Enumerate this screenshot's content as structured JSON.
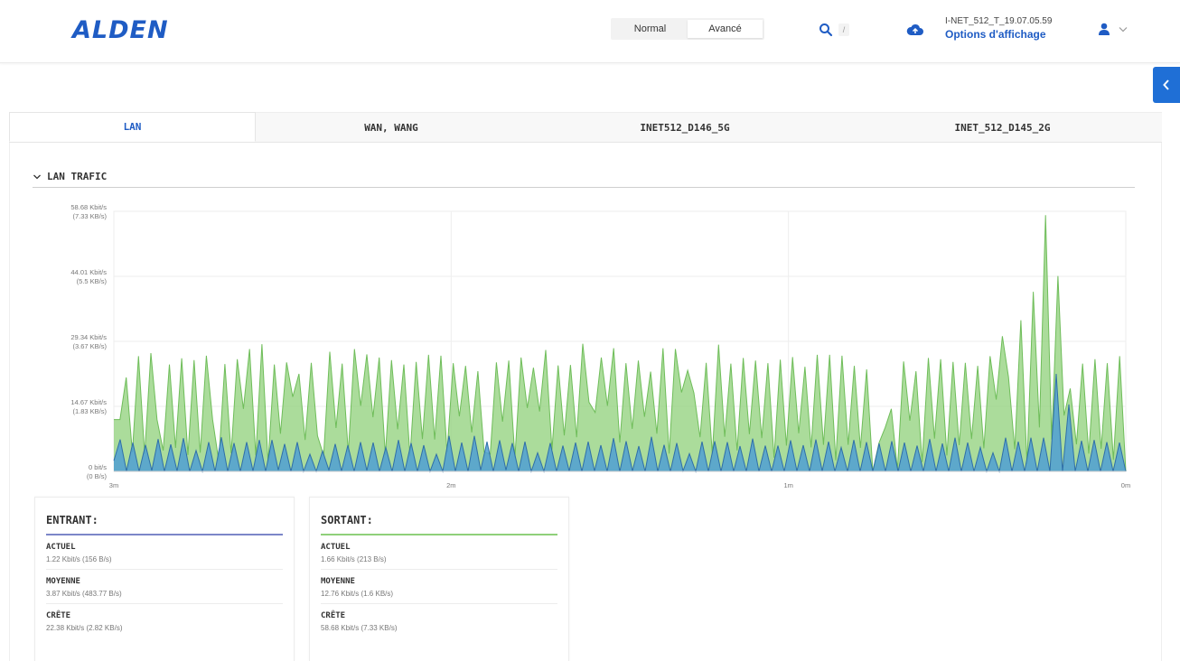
{
  "header": {
    "logo": "ALDEN",
    "modes": [
      "Normal",
      "Avancé"
    ],
    "active_mode": "Avancé",
    "search_shortcut": "/",
    "device_name": "I-NET_512_T_19.07.05.59",
    "display_options": "Options d'affichage"
  },
  "tabs": [
    {
      "label": "LAN",
      "active": true
    },
    {
      "label": "WAN, WANG",
      "active": false
    },
    {
      "label": "INET512_D146_5G",
      "active": false
    },
    {
      "label": "INET_512_D145_2G",
      "active": false
    }
  ],
  "section": {
    "title": "LAN TRAFIC"
  },
  "chart_data": {
    "type": "area",
    "y_tick_labels": [
      [
        "58.68 Kbit/s",
        "(7.33 KB/s)"
      ],
      [
        "44.01 Kbit/s",
        "(5.5 KB/s)"
      ],
      [
        "29.34 Kbit/s",
        "(3.67 KB/s)"
      ],
      [
        "14.67 Kbit/s",
        "(1.83 KB/s)"
      ],
      [
        "0 bit/s",
        "(0 B/s)"
      ]
    ],
    "y_ticks": [
      58.68,
      44.01,
      29.34,
      14.67,
      0
    ],
    "ylim": [
      0,
      58.68
    ],
    "y_unit": "Kbit/s",
    "x_tick_labels": [
      "3m",
      "2m",
      "1m",
      "0m"
    ],
    "x_ticks": [
      3,
      2,
      1,
      0
    ],
    "xlim": [
      3,
      0
    ],
    "grid": true,
    "series": [
      {
        "name": "SORTANT",
        "color": "#8fd07a",
        "values": [
          11.7,
          11.7,
          21.2,
          4.3,
          26.0,
          3.9,
          26.7,
          11.7,
          4.7,
          24.1,
          5.3,
          25.5,
          3.7,
          25.1,
          4.2,
          26.1,
          11.7,
          2.4,
          24.2,
          4.1,
          25.3,
          14.1,
          27.6,
          3.6,
          28.7,
          2.0,
          24.1,
          8.5,
          24.6,
          16.8,
          22.0,
          7.1,
          24.5,
          8.0,
          3.6,
          27.0,
          9.8,
          24.3,
          4.3,
          27.6,
          14.8,
          26.4,
          12.2,
          25.7,
          3.7,
          25.1,
          9.5,
          24.1,
          3.4,
          24.7,
          7.3,
          26.3,
          7.2,
          26.1,
          4.3,
          24.4,
          12.4,
          23.8,
          8.8,
          22.6,
          4.4,
          3.9,
          24.6,
          11.2,
          25.0,
          3.1,
          25.7,
          14.3,
          23.4,
          13.5,
          27.4,
          4.9,
          23.9,
          8.1,
          24.0,
          7.7,
          28.8,
          15.6,
          13.3,
          25.7,
          14.8,
          27.8,
          6.5,
          24.4,
          9.6,
          25.0,
          12.3,
          22.5,
          8.5,
          27.8,
          4.0,
          27.6,
          17.8,
          22.8,
          17.7,
          7.7,
          24.5,
          3.8,
          28.6,
          7.8,
          24.3,
          4.7,
          25.6,
          8.4,
          25.0,
          7.5,
          24.4,
          3.1,
          25.2,
          5.8,
          25.8,
          8.6,
          23.6,
          5.4,
          26.3,
          6.0,
          26.3,
          2.5,
          26.1,
          6.0,
          23.8,
          5.3,
          23.0,
          0.0,
          6.4,
          9.9,
          14.1,
          0.4,
          24.8,
          11.4,
          22.6,
          2.1,
          25.6,
          7.4,
          25.3,
          3.6,
          24.7,
          5.9,
          24.5,
          7.3,
          23.8,
          5.2,
          26.0,
          16.2,
          30.5,
          21.3,
          5.0,
          34.1,
          1.6,
          40.5,
          9.9,
          57.8,
          7.2,
          44.1,
          12.6,
          18.7,
          6.1,
          24.3,
          4.0,
          25.3,
          5.1,
          24.4,
          2.6,
          26.0,
          0.0
        ]
      },
      {
        "name": "ENTRANT",
        "color": "#4f9fd4",
        "values": [
          2.4,
          7.2,
          0.1,
          6.5,
          0.0,
          6.0,
          0.2,
          7.3,
          0.0,
          6.1,
          0.1,
          7.5,
          0.0,
          4.7,
          0.0,
          6.6,
          0.0,
          7.7,
          0.0,
          6.4,
          0.0,
          6.6,
          0.1,
          7.1,
          0.0,
          7.1,
          0.3,
          6.2,
          0.0,
          6.6,
          0.0,
          3.9,
          0.0,
          4.6,
          0.3,
          6.2,
          0.1,
          5.9,
          0.0,
          6.6,
          0.2,
          6.5,
          0.0,
          5.4,
          0.0,
          7.1,
          0.0,
          6.4,
          0.0,
          5.9,
          0.0,
          3.9,
          0.0,
          8.0,
          0.0,
          6.5,
          0.0,
          8.0,
          0.3,
          6.7,
          0.0,
          7.0,
          0.3,
          6.4,
          0.0,
          6.7,
          0.0,
          4.2,
          0.0,
          6.4,
          0.0,
          5.8,
          0.1,
          6.5,
          0.0,
          6.7,
          0.1,
          5.9,
          0.0,
          7.5,
          0.0,
          6.8,
          0.1,
          5.7,
          0.0,
          7.8,
          0.0,
          6.0,
          0.0,
          6.4,
          0.1,
          4.0,
          0.0,
          6.7,
          0.0,
          6.8,
          0.0,
          6.6,
          0.0,
          5.7,
          0.0,
          7.4,
          0.0,
          5.8,
          0.0,
          5.8,
          0.0,
          7.0,
          0.1,
          5.9,
          0.0,
          7.2,
          0.1,
          6.7,
          0.0,
          5.4,
          0.0,
          7.1,
          0.0,
          6.6,
          0.0,
          6.3,
          0.0,
          6.8,
          0.0,
          6.5,
          0.0,
          5.8,
          0.0,
          7.3,
          0.0,
          6.3,
          0.0,
          7.6,
          0.0,
          6.5,
          0.0,
          5.4,
          0.0,
          4.2,
          0.0,
          7.6,
          0.0,
          6.7,
          0.0,
          7.6,
          0.0,
          7.6,
          0.0,
          22.0,
          0.0,
          15.1,
          0.0,
          6.9,
          0.0,
          7.1,
          0.0,
          6.6,
          0.0,
          6.5,
          0.0
        ]
      }
    ]
  },
  "stats": {
    "incoming": {
      "title": "ENTRANT:",
      "rows": [
        {
          "label": "ACTUEL",
          "value": "1.22 Kbit/s (156 B/s)"
        },
        {
          "label": "MOYENNE",
          "value": "3.87 Kbit/s (483.77 B/s)"
        },
        {
          "label": "CRÊTE",
          "value": "22.38 Kbit/s (2.82 KB/s)"
        }
      ]
    },
    "outgoing": {
      "title": "SORTANT:",
      "rows": [
        {
          "label": "ACTUEL",
          "value": "1.66 Kbit/s (213 B/s)"
        },
        {
          "label": "MOYENNE",
          "value": "12.76 Kbit/s (1.6 KB/s)"
        },
        {
          "label": "CRÊTE",
          "value": "58.68 Kbit/s (7.33 KB/s)"
        }
      ]
    }
  }
}
